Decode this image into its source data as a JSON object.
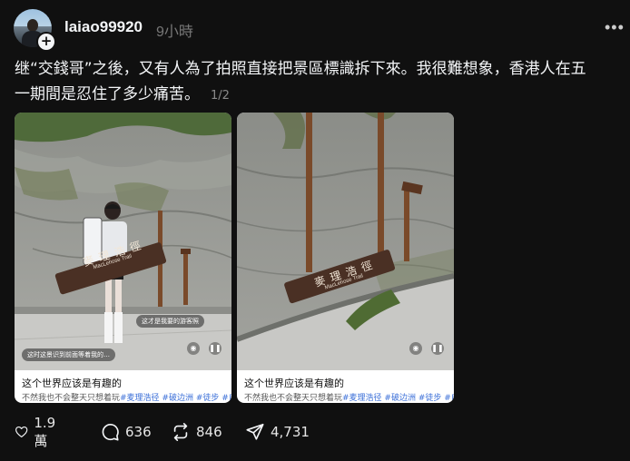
{
  "post": {
    "username": "laiao99920",
    "time": "9小時",
    "more_label": "•••",
    "caption": "继“交錢哥”之後，又有人為了拍照直接把景區標識拆下來。我很難想象，香港人在五一期間是忍住了多少痛苦。",
    "carousel_counter": "1/2"
  },
  "media": [
    {
      "sign_cn": "麥理浩徑",
      "sign_en": "MacLehose Trail",
      "title": "这个世界应该是有趣的",
      "subtitle_text": "不然我也不会整天只想着玩",
      "subtitle_tags": "#麦理浩径 #破边洲 #徒步 #自",
      "overlay_1": "这才是我要的游客照",
      "overlay_2": "这时这景识到前面等着我的…"
    },
    {
      "sign_cn": "麥理浩徑",
      "sign_en": "MacLehose Trail",
      "title": "这个世界应该是有趣的",
      "subtitle_text": "不然我也不会整天只想着玩",
      "subtitle_tags": "#麦理浩径 #破边洲 #徒步 #自"
    }
  ],
  "actions": {
    "likes": "1.9 萬",
    "replies": "636",
    "reposts": "846",
    "shares": "4,731"
  },
  "icons": {
    "like": "heart-icon",
    "reply": "comment-icon",
    "repost": "repost-icon",
    "share": "send-icon"
  },
  "colors": {
    "background": "#101010",
    "text": "#f3f5f7",
    "muted": "#777777",
    "tag": "#3b6fd8"
  }
}
